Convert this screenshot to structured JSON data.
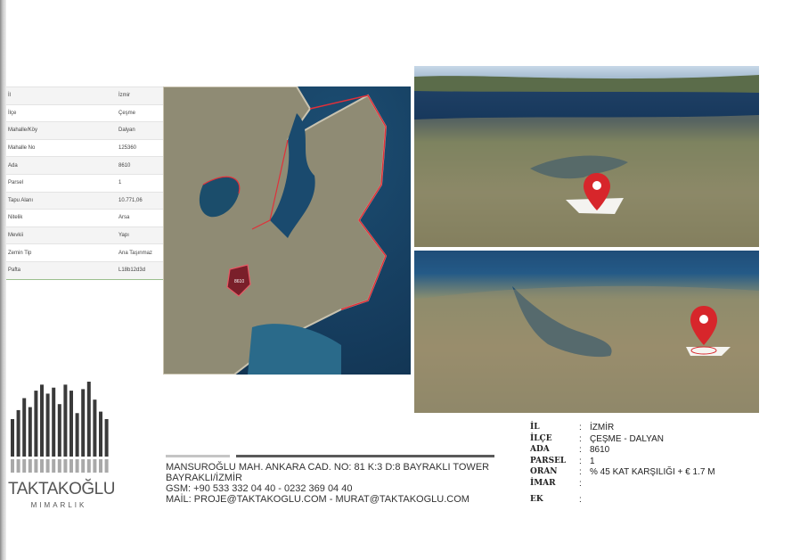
{
  "parcel_table": [
    {
      "label": "İl",
      "value": "İzmir"
    },
    {
      "label": "İlçe",
      "value": "Çeşme"
    },
    {
      "label": "Mahalle/Köy",
      "value": "Dalyan"
    },
    {
      "label": "Mahalle No",
      "value": "125360"
    },
    {
      "label": "Ada",
      "value": "8610"
    },
    {
      "label": "Parsel",
      "value": "1"
    },
    {
      "label": "Tapu Alanı",
      "value": "10.771,06"
    },
    {
      "label": "Nitelik",
      "value": "Arsa"
    },
    {
      "label": "Mevkii",
      "value": "Yapı"
    },
    {
      "label": "Zemin Tip",
      "value": "Ana Taşınmaz"
    },
    {
      "label": "Pafta",
      "value": "L18b12d3d"
    }
  ],
  "logo": {
    "name": "TAKTAKOĞLU",
    "subtitle": "MIMARLIK"
  },
  "contact": {
    "line1": "MANSUROĞLU MAH. ANKARA CAD. NO: 81 K:3  D:8 BAYRAKLI TOWER",
    "line2": "BAYRAKLI/İZMİR",
    "line3": "GSM: +90 533 332 04 40     -     0232 369 04 40",
    "line4": "MAİL: PROJE@TAKTAKOGLU.COM - MURAT@TAKTAKOGLU.COM"
  },
  "details": {
    "il": {
      "label": "İL",
      "value": "İZMİR"
    },
    "ilce": {
      "label": "İLÇE",
      "value": "ÇEŞME - DALYAN"
    },
    "ada": {
      "label": "ADA",
      "value": "8610"
    },
    "parsel": {
      "label": "PARSEL",
      "value": "1"
    },
    "oran": {
      "label": "ORAN",
      "value": "% 45 KAT KARŞILIĞI + € 1.7 M"
    },
    "imar": {
      "label": "İMAR",
      "value": ""
    },
    "ek": {
      "label": "EK",
      "value": ""
    },
    "colon": ":"
  },
  "colors": {
    "pin": "#d7262b",
    "boundary": "#e0303a",
    "sea": "#17385c"
  }
}
